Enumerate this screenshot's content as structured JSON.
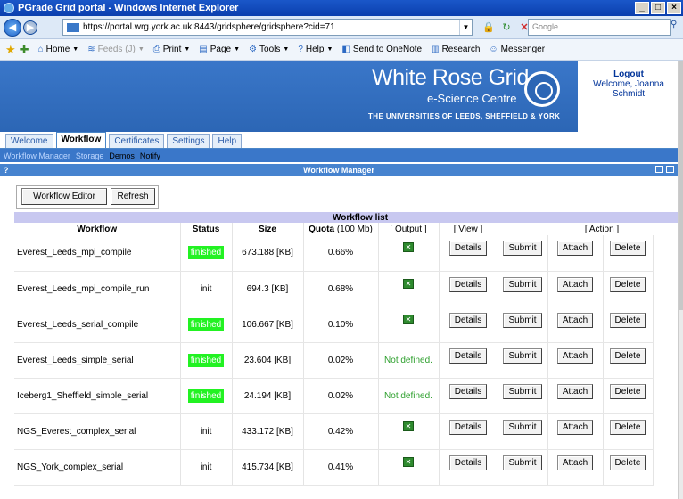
{
  "window": {
    "title": "PGrade Grid portal - Windows Internet Explorer"
  },
  "browser": {
    "url": "https://portal.wrg.york.ac.uk:8443/gridsphere/gridsphere?cid=71",
    "search_placeholder": "Google",
    "commands": [
      {
        "label": "Home",
        "icon": "home-icon",
        "disabled": false
      },
      {
        "label": "Feeds (J)",
        "icon": "feeds-icon",
        "disabled": true
      },
      {
        "label": "Print",
        "icon": "print-icon",
        "disabled": false
      },
      {
        "label": "Page",
        "icon": "page-icon",
        "disabled": false
      },
      {
        "label": "Tools",
        "icon": "tools-icon",
        "disabled": false
      },
      {
        "label": "Help",
        "icon": "help-icon",
        "disabled": false
      },
      {
        "label": "Send to OneNote",
        "icon": "onenote-icon",
        "disabled": false
      },
      {
        "label": "Research",
        "icon": "research-icon",
        "disabled": false
      },
      {
        "label": "Messenger",
        "icon": "messenger-icon",
        "disabled": false
      }
    ]
  },
  "banner": {
    "brand_line1": "White Rose Grid",
    "brand_line2": "e-Science Centre",
    "brand_line3": "THE UNIVERSITIES OF LEEDS, SHEFFIELD & YORK"
  },
  "user": {
    "logout": "Logout",
    "welcome": "Welcome, Joanna Schmidt"
  },
  "tabs": [
    "Welcome",
    "Workflow",
    "Certificates",
    "Settings",
    "Help"
  ],
  "active_tab": "Workflow",
  "subnav": [
    "Workflow Manager",
    "Storage",
    "Demos",
    "Notify"
  ],
  "portlet": {
    "icon_label": "?",
    "title": "Workflow Manager"
  },
  "toolbar": {
    "editor": "Workflow Editor",
    "refresh": "Refresh"
  },
  "table": {
    "caption": "Workflow list",
    "headers": {
      "workflow": "Workflow",
      "status": "Status",
      "size": "Size",
      "quota_bold": "Quota",
      "quota_unit": "(100 Mb)",
      "output": "[ Output ]",
      "view": "[ View ]",
      "action": "[ Action ]"
    },
    "buttons": {
      "details": "Details",
      "submit": "Submit",
      "attach": "Attach",
      "delete": "Delete"
    },
    "output_icon_glyph": "✕",
    "rows": [
      {
        "name": "Everest_Leeds_mpi_compile",
        "status": "finished",
        "size": "673.188 [KB]",
        "quota": "0.66%",
        "output": "icon"
      },
      {
        "name": "Everest_Leeds_mpi_compile_run",
        "status": "init",
        "size": "694.3 [KB]",
        "quota": "0.68%",
        "output": "icon"
      },
      {
        "name": "Everest_Leeds_serial_compile",
        "status": "finished",
        "size": "106.667 [KB]",
        "quota": "0.10%",
        "output": "icon"
      },
      {
        "name": "Everest_Leeds_simple_serial",
        "status": "finished",
        "size": "23.604 [KB]",
        "quota": "0.02%",
        "output": "Not defined."
      },
      {
        "name": "Iceberg1_Sheffield_simple_serial",
        "status": "finished",
        "size": "24.194 [KB]",
        "quota": "0.02%",
        "output": "Not defined."
      },
      {
        "name": "NGS_Everest_complex_serial",
        "status": "init",
        "size": "433.172 [KB]",
        "quota": "0.42%",
        "output": "icon"
      },
      {
        "name": "NGS_York_complex_serial",
        "status": "init",
        "size": "415.734 [KB]",
        "quota": "0.41%",
        "output": "icon"
      }
    ]
  },
  "colors": {
    "finished": "#22f222",
    "not_defined": "#2ea02e",
    "banner": "#3a77c9",
    "list_header": "#c8c8f0"
  }
}
